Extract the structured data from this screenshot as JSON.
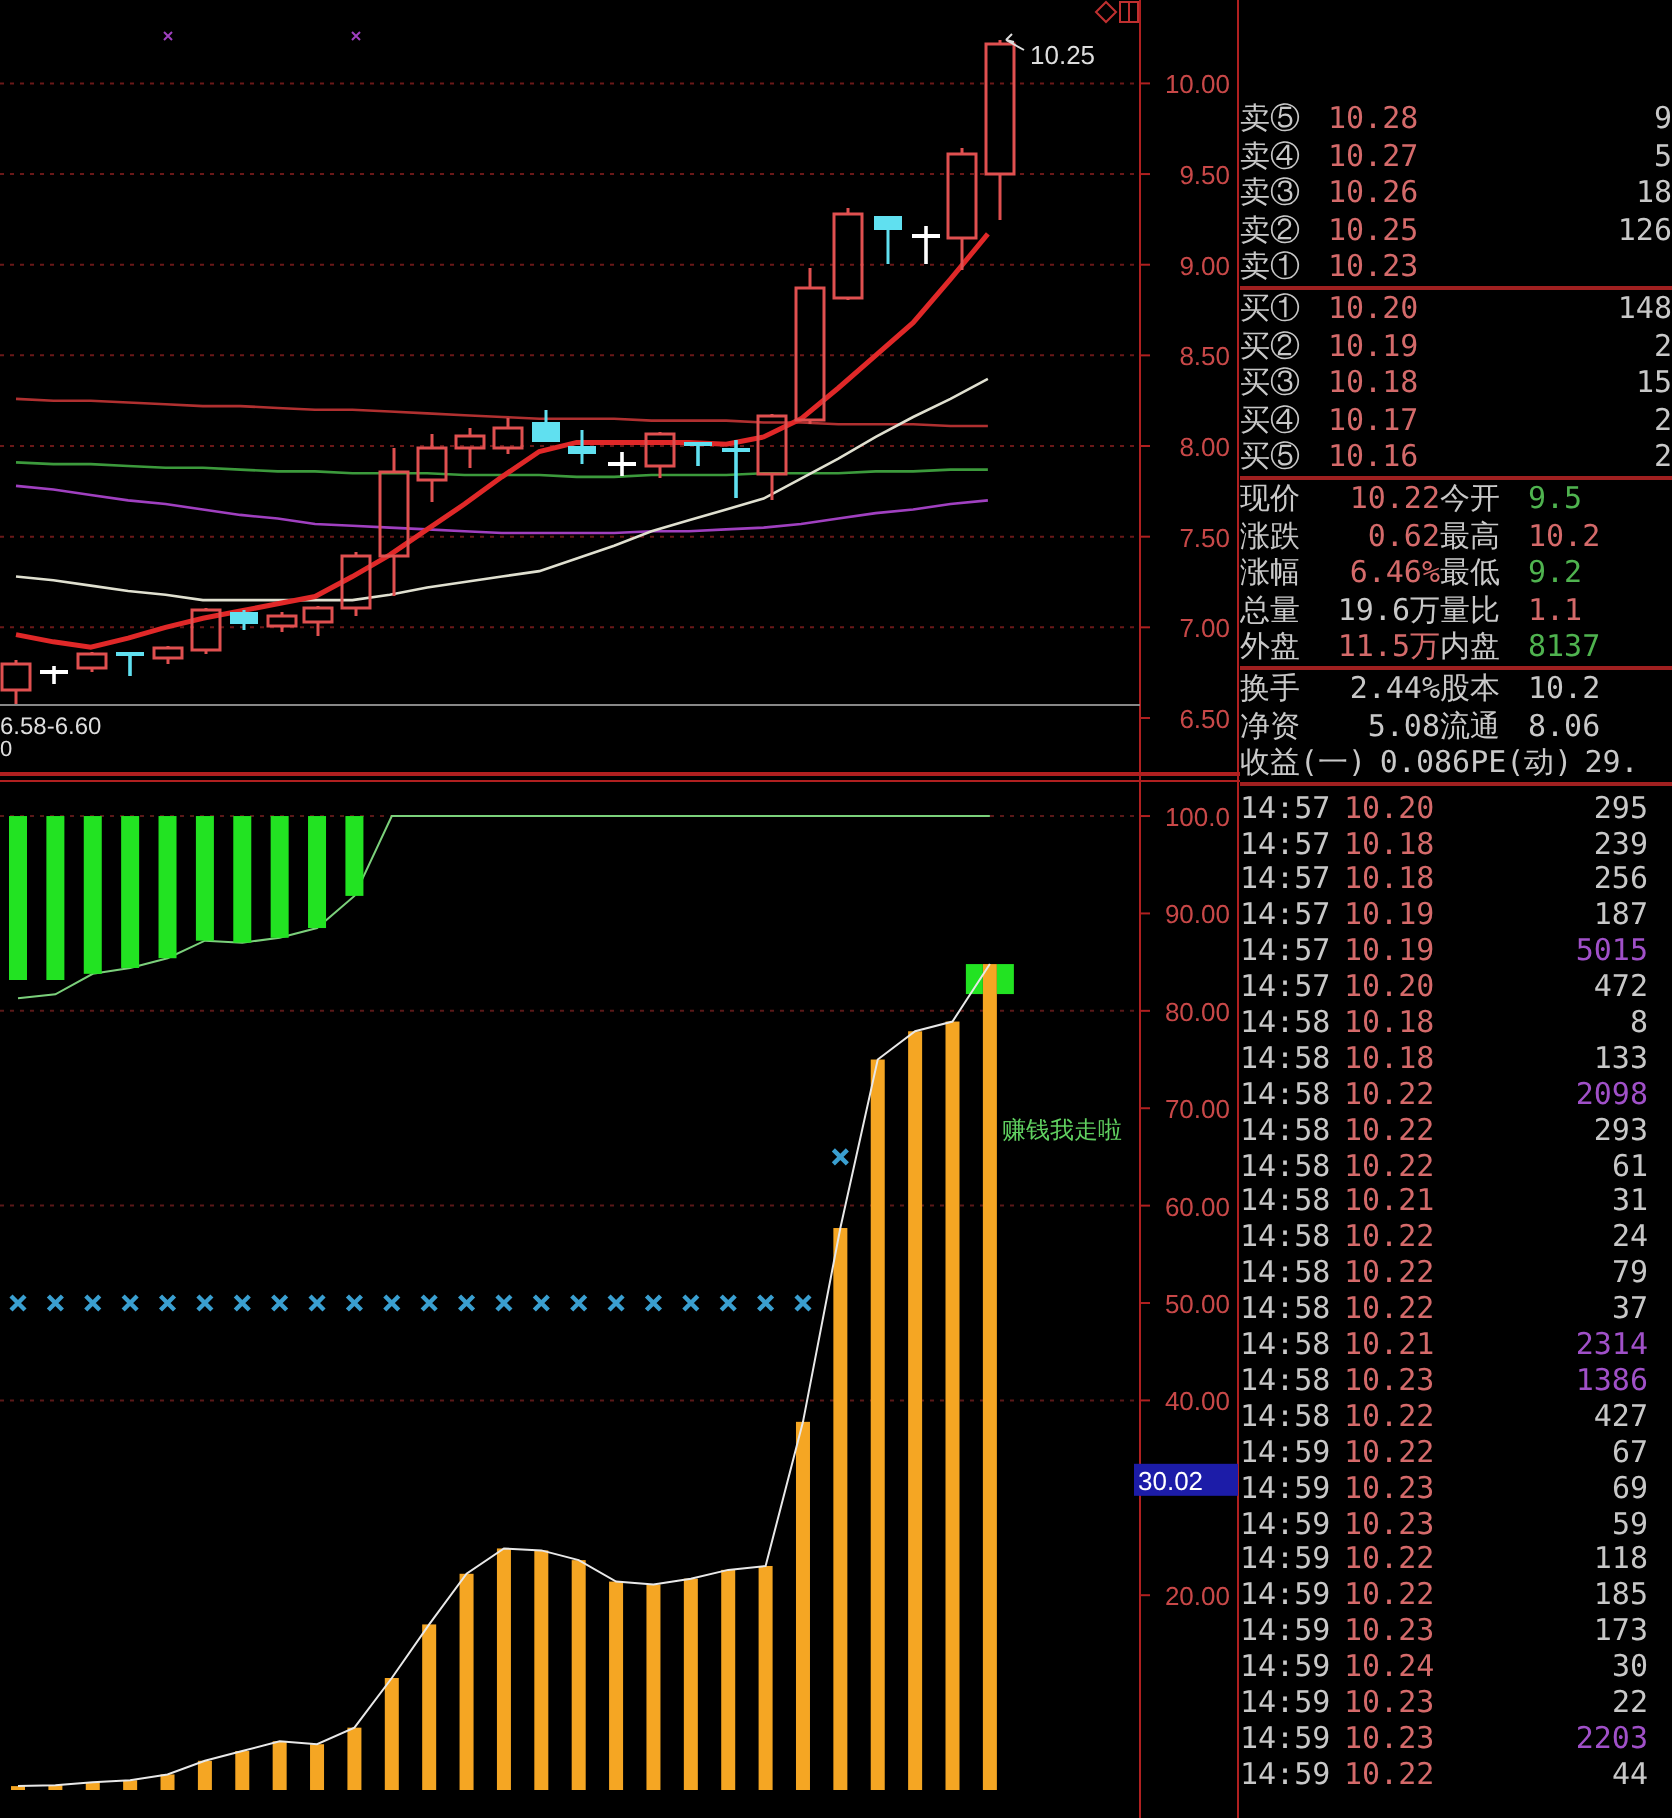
{
  "price_chart": {
    "high_label": "10.25",
    "range_label": "6.58-6.60",
    "volume_label": "0",
    "chart_data": {
      "type": "line",
      "grid": true,
      "ylim": [
        6.18,
        10.46
      ],
      "yticks": [
        {
          "value": 10,
          "label": "10.00"
        },
        {
          "value": 9.5,
          "label": "9.50"
        },
        {
          "value": 9,
          "label": "9.00"
        },
        {
          "value": 8.5,
          "label": "8.50"
        },
        {
          "value": 8,
          "label": "8.00"
        },
        {
          "value": 7.5,
          "label": "7.50"
        },
        {
          "value": 7,
          "label": "7.00"
        },
        {
          "value": 6.5,
          "label": "6.50"
        }
      ],
      "series": [
        {
          "color": "#b03030",
          "values": [
            8.26,
            8.25,
            8.25,
            8.24,
            8.23,
            8.22,
            8.22,
            8.21,
            8.2,
            8.2,
            8.19,
            8.18,
            8.17,
            8.16,
            8.15,
            8.15,
            8.15,
            8.14,
            8.14,
            8.14,
            8.13,
            8.13,
            8.12,
            8.12,
            8.12,
            8.11,
            8.11
          ]
        },
        {
          "color": "#3c9a3c",
          "values": [
            7.91,
            7.9,
            7.9,
            7.89,
            7.88,
            7.88,
            7.87,
            7.86,
            7.86,
            7.85,
            7.85,
            7.85,
            7.84,
            7.84,
            7.84,
            7.83,
            7.83,
            7.84,
            7.84,
            7.84,
            7.85,
            7.85,
            7.85,
            7.86,
            7.86,
            7.87,
            7.87
          ]
        },
        {
          "color": "#a040c0",
          "values": [
            7.78,
            7.76,
            7.73,
            7.7,
            7.68,
            7.65,
            7.62,
            7.6,
            7.57,
            7.56,
            7.55,
            7.54,
            7.53,
            7.52,
            7.52,
            7.52,
            7.52,
            7.53,
            7.53,
            7.54,
            7.55,
            7.57,
            7.6,
            7.63,
            7.65,
            7.68,
            7.7
          ]
        },
        {
          "color": "#e0e0d0",
          "values": [
            7.28,
            7.26,
            7.23,
            7.2,
            7.18,
            7.15,
            7.15,
            7.15,
            7.15,
            7.15,
            7.18,
            7.22,
            7.25,
            7.28,
            7.31,
            7.38,
            7.45,
            7.53,
            7.59,
            7.65,
            7.71,
            7.82,
            7.93,
            8.05,
            8.16,
            8.26,
            8.37
          ]
        },
        {
          "color": "#e02828",
          "values": [
            6.96,
            6.92,
            6.89,
            6.94,
            7.0,
            7.05,
            7.09,
            7.13,
            7.17,
            7.28,
            7.4,
            7.54,
            7.68,
            7.83,
            7.97,
            8.02,
            8.02,
            8.02,
            8.02,
            8.01,
            8.05,
            8.15,
            8.32,
            8.5,
            8.68,
            8.92,
            9.17
          ]
        }
      ]
    }
  },
  "indicator_chart": {
    "value_badge": "30.02",
    "chart_data": {
      "type": "bar",
      "ylim": [
        0,
        103.7
      ],
      "grid": true,
      "yticks": [
        {
          "value": 100,
          "label": "100.0"
        },
        {
          "value": 90,
          "label": "90.00"
        },
        {
          "value": 80,
          "label": "80.00"
        },
        {
          "value": 70,
          "label": "70.00"
        },
        {
          "value": 60,
          "label": "60.00"
        },
        {
          "value": 50,
          "label": "50.00"
        },
        {
          "value": 40,
          "label": "40.00"
        },
        {
          "value": 20,
          "label": "20.00"
        }
      ],
      "series": [
        {
          "type": "bar",
          "color": "#f5a623",
          "values": [
            0.4,
            0.5,
            0.8,
            1,
            1.6,
            3,
            4,
            5,
            4.7,
            6.4,
            11.5,
            17,
            22.2,
            24.8,
            24.6,
            23.6,
            21.4,
            21.1,
            21.7,
            22.6,
            23,
            37.8,
            57.7,
            75,
            77.9,
            78.9,
            84.8
          ]
        },
        {
          "type": "line",
          "color": "#e8e8e8",
          "values": [
            0.4,
            0.5,
            0.8,
            1,
            1.6,
            3,
            4,
            5,
            4.7,
            6.4,
            11.5,
            17,
            22.2,
            24.8,
            24.6,
            23.6,
            21.4,
            21.1,
            21.7,
            22.6,
            23,
            37.8,
            57.7,
            75,
            77.9,
            78.9,
            84.8
          ]
        },
        {
          "type": "line",
          "color": "#7bd07b",
          "values": [
            81.3,
            81.7,
            83.8,
            84.4,
            85.4,
            87.2,
            87,
            87.5,
            88.5,
            91.8,
            100,
            100,
            100,
            100,
            100,
            100,
            100,
            100,
            100,
            100,
            100,
            100,
            100,
            100,
            100,
            100,
            100
          ]
        },
        {
          "type": "scatter",
          "color": "#3a9fd0",
          "values": [
            50,
            50,
            50,
            50,
            50,
            50,
            50,
            50,
            50,
            50,
            50,
            50,
            50,
            50,
            50,
            50,
            50,
            50,
            50,
            50,
            50,
            50,
            65,
            null,
            null,
            null,
            null
          ]
        }
      ],
      "annotations": [
        "赚钱我走啦"
      ]
    }
  },
  "order_book": {
    "asks": [
      {
        "label": "卖⑤",
        "price": "10.28",
        "volume": "9"
      },
      {
        "label": "卖④",
        "price": "10.27",
        "volume": "5"
      },
      {
        "label": "卖③",
        "price": "10.26",
        "volume": "18"
      },
      {
        "label": "卖②",
        "price": "10.25",
        "volume": "126"
      },
      {
        "label": "卖①",
        "price": "10.23"
      }
    ],
    "bids": [
      {
        "label": "买①",
        "price": "10.20",
        "volume": "148"
      },
      {
        "label": "买②",
        "price": "10.19",
        "volume": "2"
      },
      {
        "label": "买③",
        "price": "10.18",
        "volume": "15"
      },
      {
        "label": "买④",
        "price": "10.17",
        "volume": "2"
      },
      {
        "label": "买⑤",
        "price": "10.16",
        "volume": "2"
      }
    ]
  },
  "quote": [
    {
      "label": "现价",
      "value": "10.22",
      "color": "#d46a6a"
    },
    {
      "label": "今开",
      "value": "9.5",
      "color": "#4fb34f"
    },
    {
      "label": "涨跌",
      "value": "0.62",
      "color": "#d46a6a"
    },
    {
      "label": "最高",
      "value": "10.2",
      "color": "#d46a6a"
    },
    {
      "label": "涨幅",
      "value": "6.46%",
      "color": "#d46a6a"
    },
    {
      "label": "最低",
      "value": "9.2",
      "color": "#4fb34f"
    },
    {
      "label": "总量",
      "value": "19.6万",
      "color": "#c8c8c8"
    },
    {
      "label": "量比",
      "value": "1.1",
      "color": "#d46a6a"
    },
    {
      "label": "外盘",
      "value": "11.5万",
      "color": "#d46a6a"
    },
    {
      "label": "内盘",
      "value": "8137",
      "color": "#4fb34f"
    }
  ],
  "fundamentals": [
    {
      "label": "换手",
      "value": "2.44%"
    },
    {
      "label": "股本",
      "value": "10.2"
    },
    {
      "label": "净资",
      "value": "5.08"
    },
    {
      "label": "流通",
      "value": "8.06"
    },
    {
      "label": "收益(一)",
      "value": "0.086"
    },
    {
      "label": "PE(动)",
      "value": "29."
    }
  ],
  "ticks": [
    {
      "time": "14:57",
      "price": "10.20",
      "volume": "295",
      "color": "#c8c8c8"
    },
    {
      "time": "14:57",
      "price": "10.18",
      "volume": "239",
      "color": "#c8c8c8"
    },
    {
      "time": "14:57",
      "price": "10.18",
      "volume": "256",
      "color": "#c8c8c8"
    },
    {
      "time": "14:57",
      "price": "10.19",
      "volume": "187",
      "color": "#c8c8c8"
    },
    {
      "time": "14:57",
      "price": "10.19",
      "volume": "5015",
      "color": "#a050c8"
    },
    {
      "time": "14:57",
      "price": "10.20",
      "volume": "472",
      "color": "#c8c8c8"
    },
    {
      "time": "14:58",
      "price": "10.18",
      "volume": "8",
      "color": "#c8c8c8"
    },
    {
      "time": "14:58",
      "price": "10.18",
      "volume": "133",
      "color": "#c8c8c8"
    },
    {
      "time": "14:58",
      "price": "10.22",
      "volume": "2098",
      "color": "#a050c8"
    },
    {
      "time": "14:58",
      "price": "10.22",
      "volume": "293",
      "color": "#c8c8c8"
    },
    {
      "time": "14:58",
      "price": "10.22",
      "volume": "61",
      "color": "#c8c8c8"
    },
    {
      "time": "14:58",
      "price": "10.21",
      "volume": "31",
      "color": "#c8c8c8"
    },
    {
      "time": "14:58",
      "price": "10.22",
      "volume": "24",
      "color": "#c8c8c8"
    },
    {
      "time": "14:58",
      "price": "10.22",
      "volume": "79",
      "color": "#c8c8c8"
    },
    {
      "time": "14:58",
      "price": "10.22",
      "volume": "37",
      "color": "#c8c8c8"
    },
    {
      "time": "14:58",
      "price": "10.21",
      "volume": "2314",
      "color": "#a050c8"
    },
    {
      "time": "14:58",
      "price": "10.23",
      "volume": "1386",
      "color": "#a050c8"
    },
    {
      "time": "14:58",
      "price": "10.22",
      "volume": "427",
      "color": "#c8c8c8"
    },
    {
      "time": "14:59",
      "price": "10.22",
      "volume": "67",
      "color": "#c8c8c8"
    },
    {
      "time": "14:59",
      "price": "10.23",
      "volume": "69",
      "color": "#c8c8c8"
    },
    {
      "time": "14:59",
      "price": "10.23",
      "volume": "59",
      "color": "#c8c8c8"
    },
    {
      "time": "14:59",
      "price": "10.22",
      "volume": "118",
      "color": "#c8c8c8"
    },
    {
      "time": "14:59",
      "price": "10.22",
      "volume": "185",
      "color": "#c8c8c8"
    },
    {
      "time": "14:59",
      "price": "10.23",
      "volume": "173",
      "color": "#c8c8c8"
    },
    {
      "time": "14:59",
      "price": "10.24",
      "volume": "30",
      "color": "#c8c8c8"
    },
    {
      "time": "14:59",
      "price": "10.23",
      "volume": "22",
      "color": "#c8c8c8"
    },
    {
      "time": "14:59",
      "price": "10.23",
      "volume": "2203",
      "color": "#a050c8"
    },
    {
      "time": "14:59",
      "price": "10.22",
      "volume": "44",
      "color": "#c8c8c8"
    }
  ]
}
